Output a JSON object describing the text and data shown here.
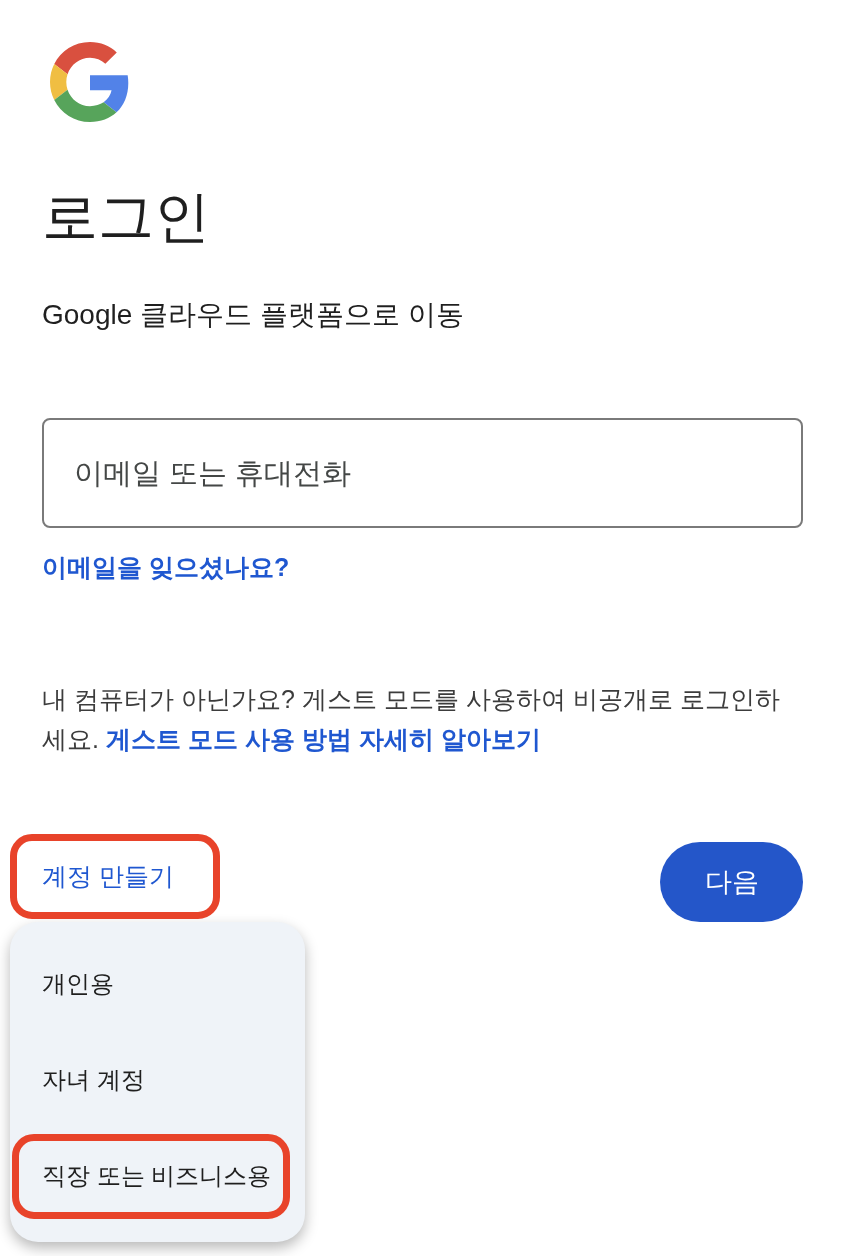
{
  "title": "로그인",
  "subtitle": "Google 클라우드 플랫폼으로 이동",
  "email_field": {
    "placeholder": "이메일 또는 휴대전화"
  },
  "forgot_email_link": "이메일을 잊으셨나요?",
  "guest_notice": {
    "text": "내 컴퓨터가 아닌가요? 게스트 모드를 사용하여 비공개로 로그인하세요.",
    "link": "게스트 모드 사용 방법 자세히 알아보기"
  },
  "create_account_button": {
    "label": "계정 만들기",
    "highlighted": true
  },
  "next_button": {
    "label": "다음"
  },
  "create_account_menu": {
    "items": [
      {
        "label": "개인용",
        "highlighted": false
      },
      {
        "label": "자녀 계정",
        "highlighted": false
      },
      {
        "label": "직장 또는 비즈니스용",
        "highlighted": true
      }
    ]
  }
}
